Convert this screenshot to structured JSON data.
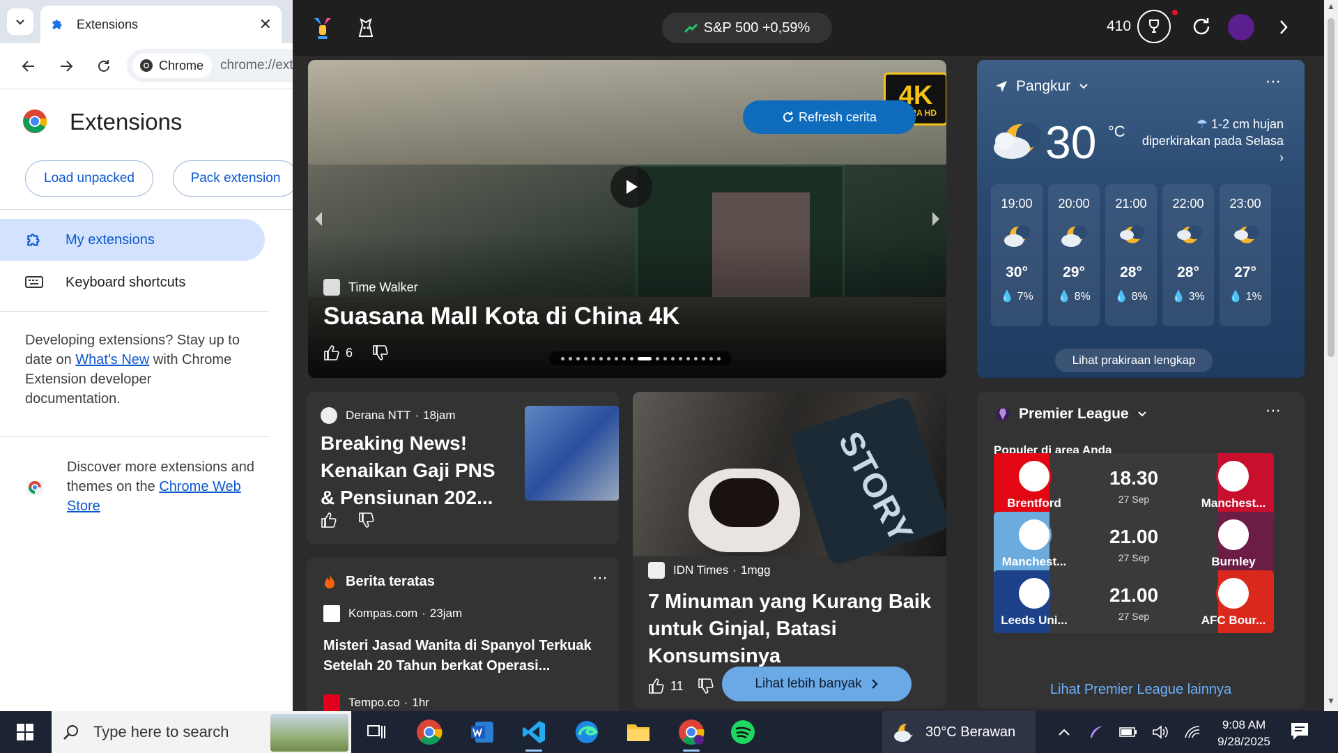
{
  "chrome": {
    "tab_title": "Extensions",
    "tab_close": "✕",
    "chip_label": "Chrome",
    "url": "chrome://extensions",
    "page_title": "Extensions",
    "load_unpacked": "Load unpacked",
    "pack_extension": "Pack extension",
    "nav": [
      {
        "label": "My extensions"
      },
      {
        "label": "Keyboard shortcuts"
      }
    ],
    "dev_text_pre": "Developing extensions? Stay up to date on ",
    "dev_link": "What's New",
    "dev_text_post": " with Chrome Extension developer documentation.",
    "store_text_pre": "Discover more extensions and themes on the ",
    "store_link": "Chrome Web Store"
  },
  "widgets": {
    "stock_label": "S&P 500 +0,59%",
    "points": "410",
    "hero": {
      "badge": "4K",
      "badge_sub": "ULTRA HD",
      "refresh_label": "Refresh cerita",
      "source": "Time Walker",
      "title": "Suasana Mall Kota di China 4K",
      "likes": "6",
      "dots_total": 20,
      "dots_active": 10
    },
    "weather": {
      "location": "Pangkur",
      "temp": "30",
      "unit": "°C",
      "forecast": "1-2 cm hujan diperkirakan pada Selasa",
      "hours": [
        {
          "time": "19:00",
          "temp": "30°",
          "rain": "7%"
        },
        {
          "time": "20:00",
          "temp": "29°",
          "rain": "8%"
        },
        {
          "time": "21:00",
          "temp": "28°",
          "rain": "8%"
        },
        {
          "time": "22:00",
          "temp": "28°",
          "rain": "3%"
        },
        {
          "time": "23:00",
          "temp": "27°",
          "rain": "1%"
        }
      ],
      "full_forecast": "Lihat prakiraan lengkap"
    },
    "derana": {
      "source": "Derana NTT",
      "age": "18jam",
      "title": "Breaking News! Kenaikan Gaji PNS & Pensiunan 202..."
    },
    "story": {
      "phone_text": "STORY",
      "source": "IDN Times",
      "age": "1mgg",
      "title": "7 Minuman yang Kurang Baik untuk Ginjal, Batasi Konsumsinya",
      "likes": "11"
    },
    "see_more": "Lihat lebih banyak",
    "berita": {
      "header": "Berita teratas",
      "item1_source": "Kompas.com",
      "item1_age": "23jam",
      "item1_title": "Misteri Jasad Wanita di Spanyol Terkuak Setelah 20 Tahun berkat Operasi...",
      "item2_source": "Tempo.co",
      "item2_age": "1hr"
    },
    "pl": {
      "header": "Premier League",
      "subheader": "Populer di area Anda",
      "matches": [
        {
          "home": "Brentford",
          "away": "Manchest...",
          "time": "18.30",
          "date": "27 Sep",
          "home_color": "#e30613",
          "away_color": "#c8102e"
        },
        {
          "home": "Manchest...",
          "away": "Burnley",
          "time": "21.00",
          "date": "27 Sep",
          "home_color": "#6cabdd",
          "away_color": "#6c1d45"
        },
        {
          "home": "Leeds Uni...",
          "away": "AFC Bour...",
          "time": "21.00",
          "date": "27 Sep",
          "home_color": "#1d428a",
          "away_color": "#da291c"
        }
      ],
      "link": "Lihat Premier League lainnya"
    }
  },
  "taskbar": {
    "search_placeholder": "Type here to search",
    "weather": "30°C  Berawan",
    "time": "9:08 AM",
    "date": "9/28/2025"
  }
}
